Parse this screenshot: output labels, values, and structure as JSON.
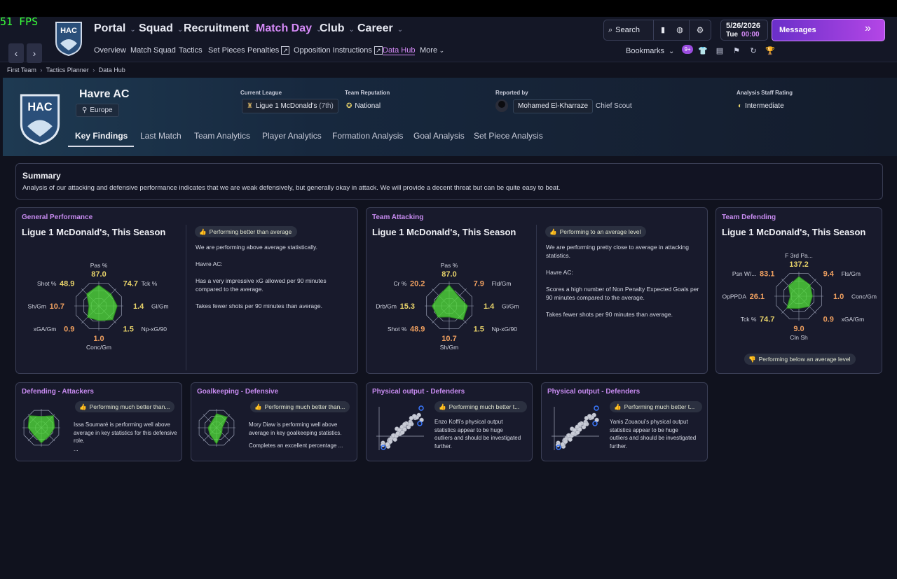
{
  "overlay": {
    "fps": "51 FPS"
  },
  "club_logo": {
    "text": "HAC"
  },
  "nav": {
    "main": [
      "Portal",
      "Squad",
      "Recruitment",
      "Match Day",
      "Club",
      "Career"
    ],
    "active_main": "Match Day",
    "sub": [
      "Overview",
      "Match Squad",
      "Tactics",
      "Set Pieces",
      "Penalties",
      "Opposition Instructions",
      "Data Hub",
      "More"
    ],
    "active_sub": "Data Hub",
    "search_label": "Search",
    "bookmarks_label": "Bookmarks",
    "bookmarks_badge": "9+",
    "date": "5/26/2026",
    "day": "Tue",
    "time": "00:00",
    "messages_label": "Messages"
  },
  "breadcrumb": [
    "First Team",
    "Tactics Planner",
    "Data Hub"
  ],
  "club": {
    "name": "Havre AC",
    "region": "Europe",
    "current_league_label": "Current League",
    "current_league": "Ligue 1 McDonald's",
    "league_position": "(7th)",
    "reputation_label": "Team Reputation",
    "reputation": "National",
    "reported_by_label": "Reported by",
    "reporter": "Mohamed El-Kharraze",
    "reporter_role": "Chief Scout",
    "staff_rating_label": "Analysis Staff Rating",
    "staff_rating": "Intermediate"
  },
  "tabs": [
    "Key Findings",
    "Last Match",
    "Team Analytics",
    "Player Analytics",
    "Formation Analysis",
    "Goal Analysis",
    "Set Piece Analysis"
  ],
  "active_tab": "Key Findings",
  "summary": {
    "title": "Summary",
    "text": "Analysis of our attacking and defensive performance indicates that we are weak defensively, but generally okay in attack. We will provide a decent threat but can be quite easy to beat."
  },
  "cards": {
    "general": {
      "title": "General Performance",
      "heading": "Ligue 1 McDonald's, This Season",
      "badge": "Performing better than average",
      "lines": [
        "We are performing above average statistically.",
        "Havre AC:",
        "Has a very impressive xG allowed per 90 minutes compared to the average.",
        "Takes fewer shots per 90 minutes than average."
      ],
      "radar": [
        {
          "label": "Pas %",
          "value": "87.0",
          "norm": 0.85
        },
        {
          "label": "Tck %",
          "value": "74.7",
          "norm": 0.7
        },
        {
          "label": "Gl/Gm",
          "value": "1.4",
          "norm": 0.75
        },
        {
          "label": "Np-xG/90",
          "value": "1.5",
          "norm": 0.8
        },
        {
          "label": "Conc/Gm",
          "value": "1.0",
          "norm": 0.6
        },
        {
          "label": "xGA/Gm",
          "value": "0.9",
          "norm": 0.65
        },
        {
          "label": "Sh/Gm",
          "value": "10.7",
          "norm": 0.4
        },
        {
          "label": "Shot %",
          "value": "48.9",
          "norm": 0.7
        }
      ]
    },
    "attacking": {
      "title": "Team Attacking",
      "heading": "Ligue 1 McDonald's, This Season",
      "badge": "Performing to an average level",
      "lines": [
        "We are performing pretty close to average in attacking statistics.",
        "Havre AC:",
        "Scores a high number of Non Penalty Expected Goals per 90 minutes compared to the average.",
        "Takes fewer shots per 90 minutes than average."
      ],
      "radar": [
        {
          "label": "Pas %",
          "value": "87.0",
          "norm": 0.85
        },
        {
          "label": "Fld/Gm",
          "value": "7.9",
          "norm": 0.55
        },
        {
          "label": "Gl/Gm",
          "value": "1.4",
          "norm": 0.75
        },
        {
          "label": "Np-xG/90",
          "value": "1.5",
          "norm": 0.8
        },
        {
          "label": "Sh/Gm",
          "value": "10.7",
          "norm": 0.45
        },
        {
          "label": "Shot %",
          "value": "48.9",
          "norm": 0.65
        },
        {
          "label": "Drb/Gm",
          "value": "15.3",
          "norm": 0.7
        },
        {
          "label": "Cr %",
          "value": "20.2",
          "norm": 0.6
        }
      ]
    },
    "defending": {
      "title": "Team Defending",
      "heading": "Ligue 1 McDonald's, This Season",
      "badge": "Performing below an average level",
      "radar": [
        {
          "label": "F 3rd Pa...",
          "value": "137.2",
          "norm": 0.8
        },
        {
          "label": "Fls/Gm",
          "value": "9.4",
          "norm": 0.65
        },
        {
          "label": "Conc/Gm",
          "value": "1.0",
          "norm": 0.55
        },
        {
          "label": "xGA/Gm",
          "value": "0.9",
          "norm": 0.6
        },
        {
          "label": "Cln Sh",
          "value": "9.0",
          "norm": 0.5
        },
        {
          "label": "Tck %",
          "value": "74.7",
          "norm": 0.7
        },
        {
          "label": "OpPPDA",
          "value": "26.1",
          "norm": 0.35
        },
        {
          "label": "Psn W/...",
          "value": "83.1",
          "norm": 0.6
        }
      ]
    },
    "def_attackers": {
      "title": "Defending - Attackers",
      "badge": "Performing much better than...",
      "lines": [
        "Issa Soumaré is performing well above average in key statistics for this defensive role.",
        "..."
      ],
      "radar_norms": [
        0.6,
        0.9,
        0.7,
        0.6,
        0.8,
        0.55,
        0.7,
        0.9
      ]
    },
    "goalkeeping": {
      "title": "Goalkeeping - Defensive",
      "badge": "Performing much better than...",
      "lines": [
        "Mory Diaw is performing well above average in key goalkeeping statistics.",
        "Completes an excellent percentage ..."
      ],
      "radar_norms": [
        0.75,
        0.8,
        0.3,
        0.4,
        0.85,
        0.5,
        0.45,
        0.4
      ]
    },
    "phys1": {
      "title": "Physical output - Defenders",
      "badge": "Performing much better t...",
      "lines": [
        "Enzo Koffi's physical output statistics appear to be huge outliers and should be investigated further."
      ]
    },
    "phys2": {
      "title": "Physical output - Defenders",
      "badge": "Performing much better t...",
      "lines": [
        "Yanis Zouaoui's physical output statistics appear to be huge outliers and should be investigated further."
      ]
    }
  },
  "colors": {
    "accent_purple": "#c78bf0",
    "radar_fill": "#4fd63a",
    "value_yellow": "#e8d36a",
    "value_orange": "#f0a060"
  }
}
